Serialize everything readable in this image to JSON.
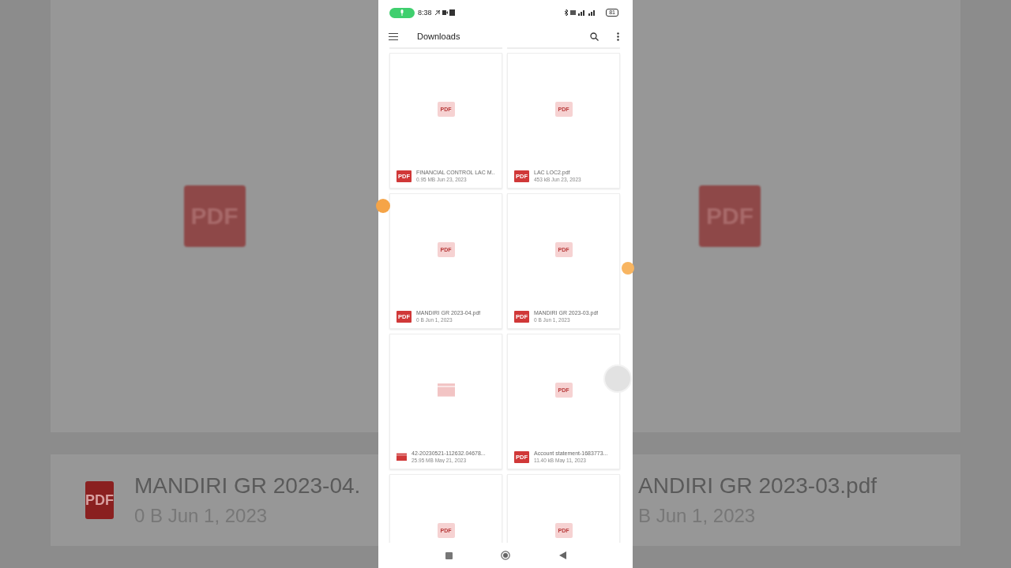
{
  "backdrop": {
    "left": {
      "badge": "PDF",
      "file_badge": "PDF",
      "name": "MANDIRI GR 2023-04.",
      "meta": "0 B  Jun 1, 2023"
    },
    "right": {
      "badge": "PDF",
      "name": "ANDIRI GR 2023-03.pdf",
      "meta": "B  Jun 1, 2023"
    }
  },
  "status_bar": {
    "time": "8:38",
    "battery": "81"
  },
  "app_bar": {
    "title": "Downloads"
  },
  "files": [
    {
      "kind": "pdf",
      "badge": "PDF",
      "icon_label": "PDF",
      "name": "FINANCIAL CONTROL LAC M...",
      "meta": "0.95 MB  Jun 23, 2023"
    },
    {
      "kind": "pdf",
      "badge": "PDF",
      "icon_label": "PDF",
      "name": "LAC LOC2.pdf",
      "meta": "453 kB  Jun 23, 2023"
    },
    {
      "kind": "pdf",
      "badge": "PDF",
      "icon_label": "PDF",
      "name": "MANDIRI GR 2023-04.pdf",
      "meta": "0 B  Jun 1, 2023"
    },
    {
      "kind": "pdf",
      "badge": "PDF",
      "icon_label": "PDF",
      "name": "MANDIRI GR 2023-03.pdf",
      "meta": "0 B  Jun 1, 2023"
    },
    {
      "kind": "video",
      "name": "42-20230521-112632.04678...",
      "meta": "25.95 MB  May 21, 2023"
    },
    {
      "kind": "pdf",
      "badge": "PDF",
      "icon_label": "PDF",
      "name": "Account statement-1683773...",
      "meta": "11.40 kB  May 11, 2023"
    },
    {
      "kind": "pdf",
      "badge": "PDF"
    },
    {
      "kind": "pdf",
      "badge": "PDF"
    }
  ]
}
